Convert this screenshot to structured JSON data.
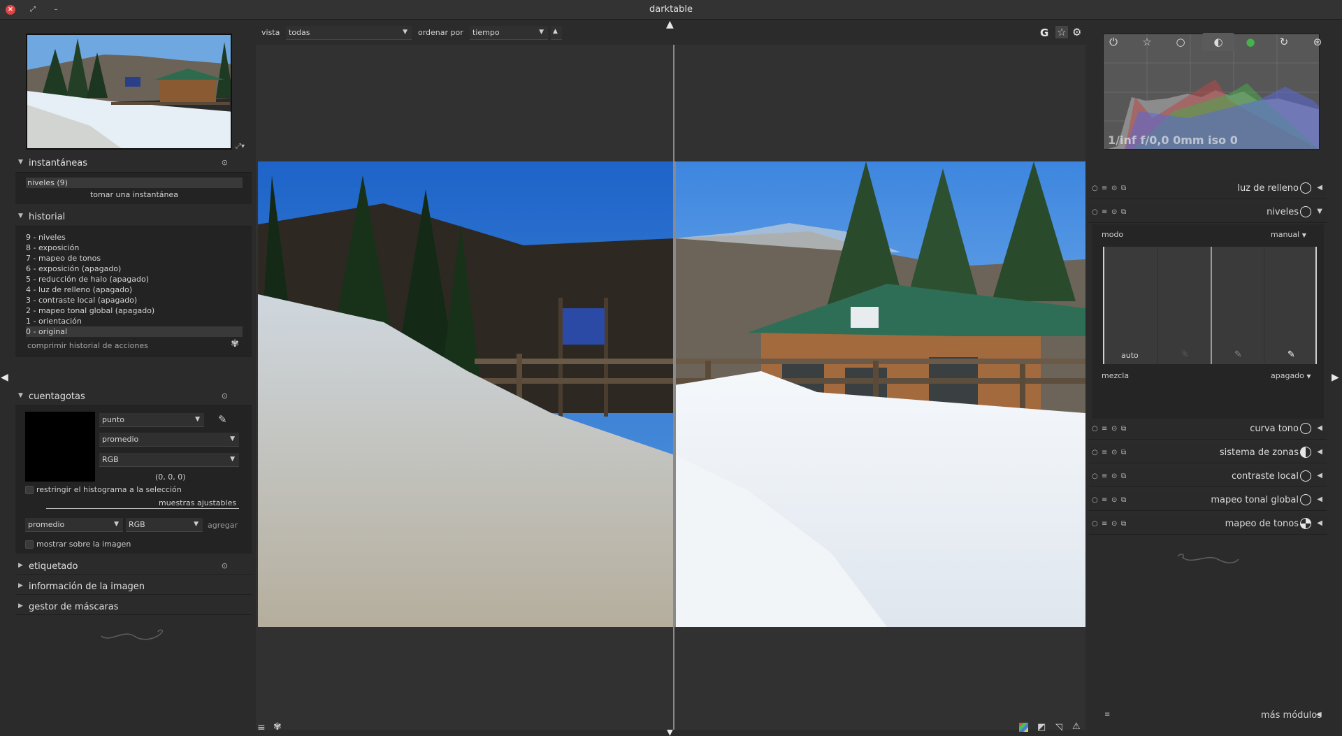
{
  "window": {
    "title": "darktable"
  },
  "left": {
    "snapshots": {
      "title": "instantáneas",
      "items": [
        "niveles (9)"
      ],
      "take_label": "tomar una instantánea"
    },
    "history": {
      "title": "historial",
      "items": [
        "9 - niveles",
        "8 - exposición",
        "7 - mapeo de tonos",
        "6 - exposición (apagado)",
        "5 - reducción de halo (apagado)",
        "4 - luz de relleno (apagado)",
        "3 - contraste local (apagado)",
        "2 - mapeo tonal global (apagado)",
        "1 - orientación",
        "0 - original"
      ],
      "compress_label": "comprimir historial de acciones"
    },
    "colorpicker": {
      "title": "cuentagotas",
      "mode": "punto",
      "stat": "promedio",
      "model": "RGB",
      "value": "(0, 0, 0)",
      "restrict_label": "restringir el histograma a la selección",
      "samples_label": "muestras ajustables",
      "sample_stat": "promedio",
      "sample_model": "RGB",
      "add_label": "agregar",
      "overlay_label": "mostrar sobre la imagen"
    },
    "collapsed": [
      "etiquetado",
      "información de la imagen",
      "gestor de máscaras"
    ]
  },
  "top": {
    "view_label": "vista",
    "view_value": "todas",
    "sort_label": "ordenar por",
    "sort_value": "tiempo",
    "g_label": "G"
  },
  "right": {
    "histogram_info": "1/inf f/0,0 0mm iso 0",
    "modules_top": [
      {
        "name": "luz de relleno"
      },
      {
        "name": "niveles"
      }
    ],
    "levels": {
      "mode_label": "modo",
      "mode_value": "manual",
      "auto_label": "auto",
      "blend_label": "mezcla",
      "blend_value": "apagado"
    },
    "modules_bottom": [
      {
        "name": "curva tono"
      },
      {
        "name": "sistema de zonas"
      },
      {
        "name": "contraste local"
      },
      {
        "name": "mapeo tonal global"
      },
      {
        "name": "mapeo de tonos"
      }
    ],
    "more_modules": "más módulos"
  },
  "colors": {
    "accent": "#e04545",
    "panel": "#2b2b2b"
  }
}
